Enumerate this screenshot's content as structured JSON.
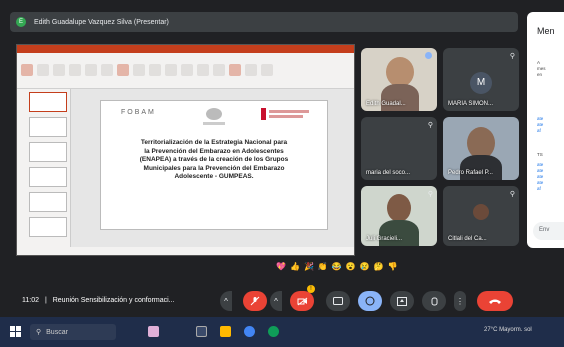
{
  "top_bar": {
    "presenter_label": "Edith Guadalupe Vazquez Silva (Presentar)",
    "initial": "E"
  },
  "slide": {
    "logo_left": "FOBAM",
    "text": "Territorialización de la Estrategia Nacional para\nla Prevención del Embarazo en Adolescentes\n(ENAPEA) a través de la creación de los Grupos\nMunicipales para la Prevención del Embarazo\nAdolescente - GUMPEAS."
  },
  "participants": [
    {
      "label": "Edith Guadal..."
    },
    {
      "label": "MARIA SIMON...",
      "initial": "M"
    },
    {
      "label": "maria del soco..."
    },
    {
      "label": "Pedro Rafael P..."
    },
    {
      "label": "Juli Gracieli..."
    },
    {
      "label": "Citlali del Ca..."
    }
  ],
  "reactions": [
    "💖",
    "👍",
    "🎉",
    "👏",
    "😂",
    "😮",
    "😢",
    "🤔",
    "👎"
  ],
  "meeting": {
    "time": "11:02",
    "title": "Reunión Sensibilización y conformaci..."
  },
  "side_panel": {
    "title": "Men",
    "input_placeholder": "Env"
  },
  "taskbar": {
    "search_placeholder": "Buscar",
    "weather": "27°C  Mayorm. sol"
  },
  "colors": {
    "end_call": "#ea4335",
    "accent_blue": "#8ab4f8",
    "powerpoint": "#c43e1c"
  }
}
